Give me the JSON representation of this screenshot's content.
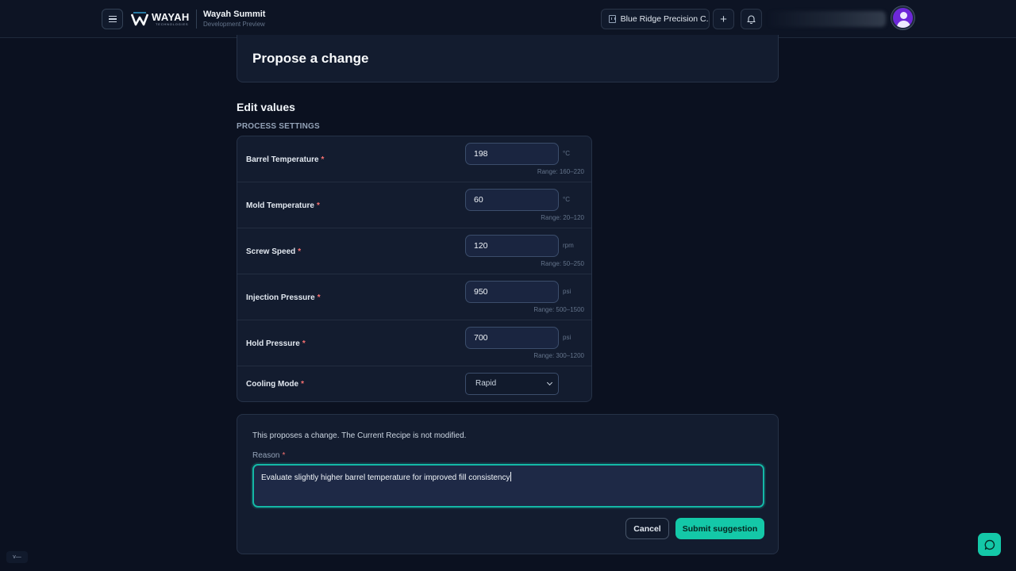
{
  "header": {
    "logo_text": "WAYAH",
    "logo_subtext": "TECHNOLOGIES",
    "app_title": "Wayah Summit",
    "app_subtitle": "Development Preview",
    "org_selector_label": "Blue Ridge Precision C...",
    "add_label": "+"
  },
  "page": {
    "title": "Propose a change",
    "section_title": "Edit values",
    "section_subtitle": "PROCESS SETTINGS"
  },
  "settings": [
    {
      "label": "Barrel Temperature",
      "required": "*",
      "value": "198",
      "unit": "°C",
      "range": "Range: 160–220"
    },
    {
      "label": "Mold Temperature",
      "required": "*",
      "value": "60",
      "unit": "°C",
      "range": "Range: 20–120"
    },
    {
      "label": "Screw Speed",
      "required": "*",
      "value": "120",
      "unit": "rpm",
      "range": "Range: 50–250"
    },
    {
      "label": "Injection Pressure",
      "required": "*",
      "value": "950",
      "unit": "psi",
      "range": "Range: 500–1500"
    },
    {
      "label": "Hold Pressure",
      "required": "*",
      "value": "700",
      "unit": "psi",
      "range": "Range: 300–1200"
    },
    {
      "label": "Cooling Mode",
      "required": "*",
      "value": "Rapid"
    }
  ],
  "reason": {
    "notice": "This proposes a change. The Current Recipe is not modified.",
    "label": "Reason",
    "required": "*",
    "value": "Evaluate slightly higher barrel temperature for improved fill consistency"
  },
  "actions": {
    "cancel_label": "Cancel",
    "submit_label": "Submit suggestion"
  },
  "footer": {
    "version_label": "v—"
  },
  "colors": {
    "accent": "#14c8a8",
    "background": "#0b1120",
    "card": "#131c2f",
    "required": "#f87171"
  }
}
